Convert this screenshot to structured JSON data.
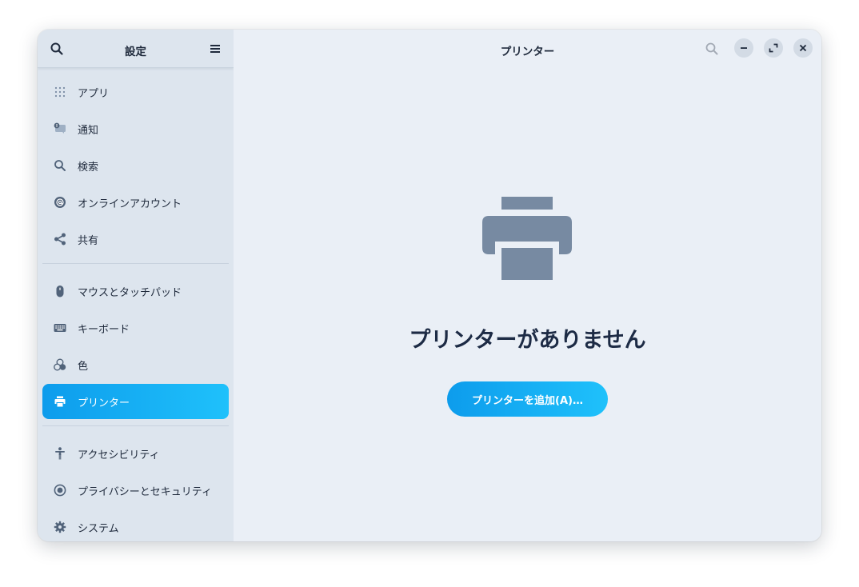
{
  "sidebar": {
    "title": "設定",
    "groups": [
      [
        {
          "label": "アプリ",
          "icon": "apps-grid-icon"
        },
        {
          "label": "通知",
          "icon": "notifications-icon"
        },
        {
          "label": "検索",
          "icon": "search-icon"
        },
        {
          "label": "オンラインアカウント",
          "icon": "at-sign-icon"
        },
        {
          "label": "共有",
          "icon": "share-icon"
        }
      ],
      [
        {
          "label": "マウスとタッチパッド",
          "icon": "mouse-icon"
        },
        {
          "label": "キーボード",
          "icon": "keyboard-icon"
        },
        {
          "label": "色",
          "icon": "color-icon"
        },
        {
          "label": "プリンター",
          "icon": "printer-icon",
          "active": true
        }
      ],
      [
        {
          "label": "アクセシビリティ",
          "icon": "accessibility-icon"
        },
        {
          "label": "プライバシーとセキュリティ",
          "icon": "privacy-icon"
        },
        {
          "label": "システム",
          "icon": "gear-icon"
        }
      ]
    ]
  },
  "header": {
    "title": "プリンター"
  },
  "main": {
    "empty_icon": "printer-icon",
    "empty_title": "プリンターがありません",
    "add_button_label": "プリンターを追加(A)…"
  },
  "colors": {
    "accent_start": "#0d9cec",
    "accent_end": "#1fc1fb",
    "sidebar_bg": "#dde5ee",
    "content_bg": "#eaeff6",
    "icon_gray": "#778aa2"
  }
}
